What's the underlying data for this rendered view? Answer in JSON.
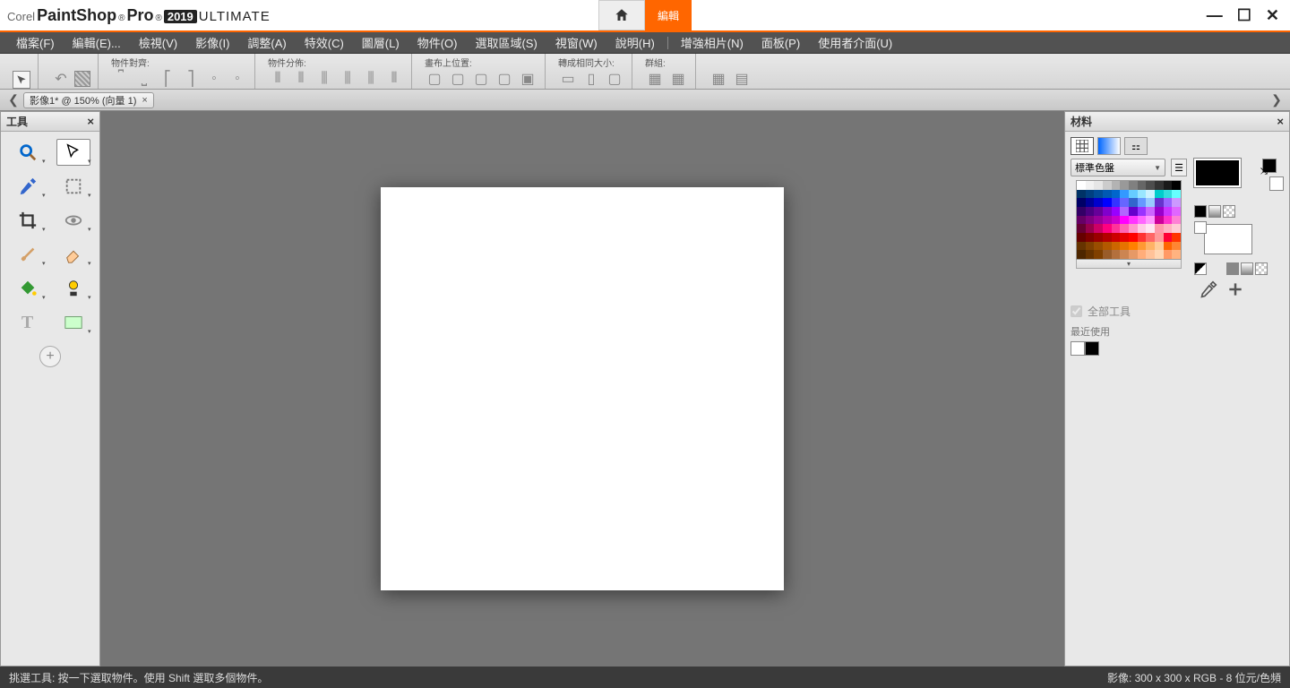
{
  "title": {
    "corel": "Corel",
    "app": "PaintShop",
    "pro": "Pro",
    "year": "2019",
    "edition": "ULTIMATE"
  },
  "mode_tabs": {
    "home": "⌂",
    "edit": "編輯"
  },
  "window_controls": {
    "min": "—",
    "max": "☐",
    "close": "✕"
  },
  "menu": {
    "file": "檔案(F)",
    "edit": "編輯(E)...",
    "view": "檢視(V)",
    "image": "影像(I)",
    "adjust": "調整(A)",
    "effects": "特效(C)",
    "layers": "圖層(L)",
    "objects": "物件(O)",
    "selections": "選取區域(S)",
    "window": "視窗(W)",
    "help": "說明(H)",
    "enhance": "增強相片(N)",
    "panels": "面板(P)",
    "ui": "使用者介面(U)"
  },
  "options": {
    "group1": "物件對齊:",
    "group2": "物件分佈:",
    "group3": "畫布上位置:",
    "group4": "轉成相同大小:",
    "group5": "群組:"
  },
  "doc_tab": {
    "label": "影像1* @ 150% (向量 1)",
    "close": "×"
  },
  "tools_panel": {
    "title": "工具"
  },
  "materials": {
    "title": "材料",
    "palette_select": "標準色盤",
    "all_tools": "全部工具",
    "recent": "最近使用"
  },
  "statusbar": {
    "left": "挑選工具: 按一下選取物件。使用 Shift 選取多個物件。",
    "right": "影像:  300 x 300 x RGB - 8 位元/色頻"
  },
  "swatches": {
    "rows": [
      [
        "#ffffff",
        "#f2f2f2",
        "#e6e6e6",
        "#cccccc",
        "#b3b3b3",
        "#999999",
        "#808080",
        "#666666",
        "#4d4d4d",
        "#333333",
        "#1a1a1a",
        "#000000"
      ],
      [
        "#003366",
        "#004080",
        "#004d99",
        "#0059b3",
        "#0066cc",
        "#3399ff",
        "#66ccff",
        "#99e6ff",
        "#ccf2ff",
        "#00cccc",
        "#33dddd",
        "#66ffff"
      ],
      [
        "#000066",
        "#000099",
        "#0000cc",
        "#0000ff",
        "#3333ff",
        "#6666ff",
        "#3366cc",
        "#6699ff",
        "#99ccff",
        "#6633cc",
        "#9966ff",
        "#cc99ff"
      ],
      [
        "#330066",
        "#4b0082",
        "#660099",
        "#8000cc",
        "#9900ff",
        "#b266ff",
        "#6600cc",
        "#9933ff",
        "#cc66ff",
        "#9900cc",
        "#cc33ff",
        "#e066ff"
      ],
      [
        "#660066",
        "#800080",
        "#990099",
        "#b300b3",
        "#cc00cc",
        "#ff00ff",
        "#ff33ff",
        "#ff66ff",
        "#ff99ff",
        "#cc0099",
        "#ff33cc",
        "#ff80d5"
      ],
      [
        "#660033",
        "#99004d",
        "#cc0066",
        "#ff0080",
        "#ff3399",
        "#ff66b3",
        "#ff99cc",
        "#ffcce6",
        "#ffe6f2",
        "#ff99aa",
        "#ffb3c1",
        "#ffccd5"
      ],
      [
        "#660000",
        "#800000",
        "#990000",
        "#b30000",
        "#cc0000",
        "#e60000",
        "#ff0000",
        "#ff3333",
        "#ff6666",
        "#ff9999",
        "#ff0033",
        "#ff3300"
      ],
      [
        "#663300",
        "#804000",
        "#994d00",
        "#b35900",
        "#cc6600",
        "#e67300",
        "#ff8000",
        "#ff9933",
        "#ffb366",
        "#ffcc99",
        "#ff6600",
        "#ff8533"
      ],
      [
        "#4d2600",
        "#663300",
        "#804000",
        "#995c29",
        "#b3703d",
        "#cc8552",
        "#e69966",
        "#ffad7a",
        "#ffc299",
        "#ffd6b3",
        "#ff9966",
        "#ffb380"
      ]
    ],
    "recent": [
      "#ffffff",
      "#000000"
    ]
  }
}
